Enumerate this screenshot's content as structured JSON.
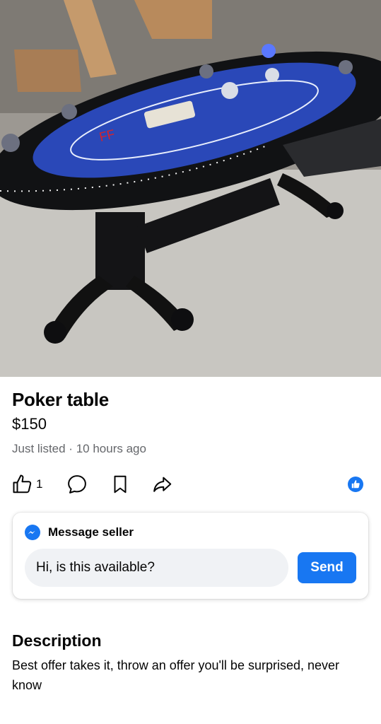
{
  "listing": {
    "title": "Poker table",
    "price": "$150",
    "meta": "Just listed · 10 hours ago",
    "like_count": "1"
  },
  "message": {
    "header": "Message seller",
    "input_value": "Hi, is this available?",
    "send_label": "Send"
  },
  "description": {
    "heading": "Description",
    "body": "Best offer takes it, throw an offer you'll be surprised, never know"
  },
  "icons": {
    "like": "thumbs-up-icon",
    "comment": "comment-bubble-icon",
    "save": "bookmark-icon",
    "share": "share-arrow-icon",
    "messenger": "messenger-icon",
    "like_badge": "like-badge-icon"
  },
  "colors": {
    "accent": "#1877f2",
    "secondary_text": "#65676b",
    "input_bg": "#f0f2f5"
  }
}
